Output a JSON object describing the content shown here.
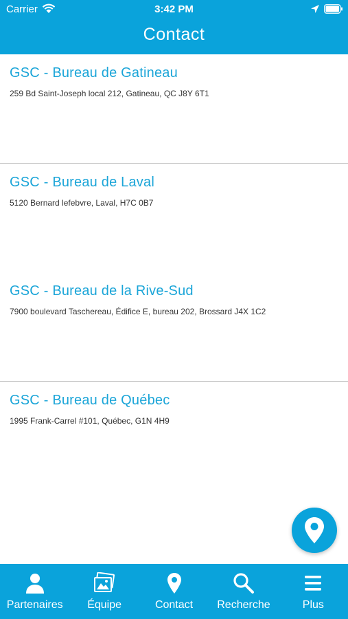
{
  "status_bar": {
    "carrier": "Carrier",
    "time": "3:42 PM"
  },
  "header": {
    "title": "Contact"
  },
  "offices": [
    {
      "name": "GSC - Bureau de Gatineau",
      "address": "259 Bd Saint-Joseph local 212, Gatineau, QC J8Y 6T1"
    },
    {
      "name": "GSC - Bureau de Laval",
      "address": "5120 Bernard lefebvre, Laval, H7C 0B7"
    },
    {
      "name": "GSC - Bureau de la Rive-Sud",
      "address": "7900 boulevard Taschereau, Édifice E, bureau 202, Brossard J4X 1C2"
    },
    {
      "name": "GSC - Bureau de Québec",
      "address": "1995 Frank-Carrel #101, Québec, G1N 4H9"
    }
  ],
  "tab_bar": {
    "items": [
      {
        "label": "Partenaires",
        "icon": "person-icon"
      },
      {
        "label": "Équipe",
        "icon": "photos-icon"
      },
      {
        "label": "Contact",
        "icon": "map-pin-icon"
      },
      {
        "label": "Recherche",
        "icon": "search-icon"
      },
      {
        "label": "Plus",
        "icon": "menu-icon"
      }
    ]
  },
  "colors": {
    "accent": "#0aa3db",
    "title_text": "#1ba5d8",
    "divider": "#c8c8c8"
  }
}
